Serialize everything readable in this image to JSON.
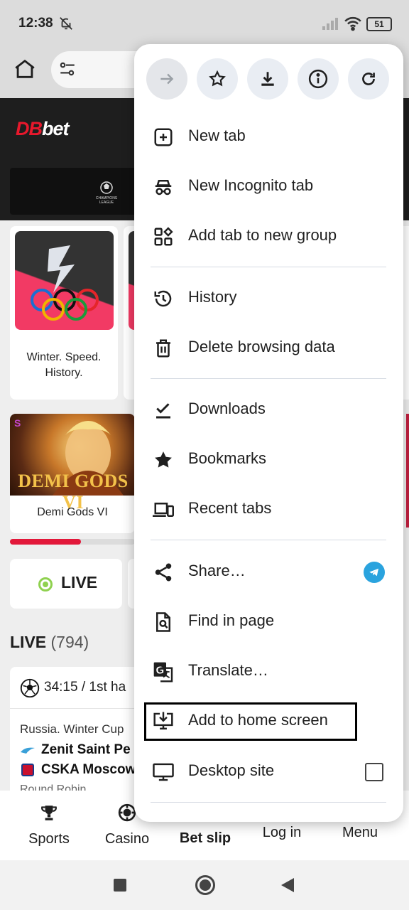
{
  "status_bar": {
    "time": "12:38",
    "battery": "51"
  },
  "site": {
    "logo_db": "DB",
    "logo_bet": "bet",
    "promo_logo_text": "CHAMPIONS LEAGUE",
    "game_card_1_title": "Winter. Speed. History.",
    "game_card_2_title": "Demi Gods VI",
    "game_card_2_art_text": "DEMI GODS VI",
    "live_button": "LIVE",
    "live_section_title": "LIVE",
    "live_count": "(794)",
    "match": {
      "time": "34:15 / 1st ha",
      "league": "Russia. Winter Cup",
      "team1": "Zenit Saint Pe",
      "team2": "CSKA Moscow",
      "stage": "Round Robin"
    }
  },
  "bottom_nav": {
    "items": [
      "Sports",
      "Casino",
      "Bet slip",
      "Log in",
      "Menu"
    ]
  },
  "menu": {
    "items": {
      "new_tab": "New tab",
      "incognito": "New Incognito tab",
      "add_group": "Add tab to new group",
      "history": "History",
      "delete_data": "Delete browsing data",
      "downloads": "Downloads",
      "bookmarks": "Bookmarks",
      "recent_tabs": "Recent tabs",
      "share": "Share…",
      "find": "Find in page",
      "translate": "Translate…",
      "add_home": "Add to home screen",
      "desktop": "Desktop site"
    }
  },
  "colors": {
    "brand_red": "#e8182c",
    "live_green": "#8fd14f",
    "telegram_blue": "#2aa3de"
  }
}
